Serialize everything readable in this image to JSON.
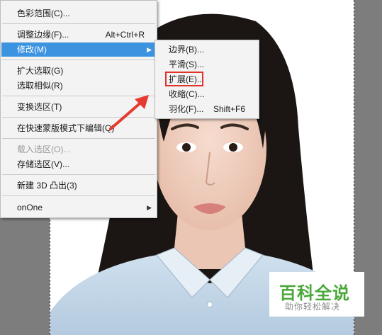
{
  "main_menu": {
    "items": [
      {
        "label": "色彩范围(C)...",
        "shortcut": ""
      },
      {
        "label": "调整边缘(F)...",
        "shortcut": "Alt+Ctrl+R"
      },
      {
        "label": "修改(M)",
        "shortcut": "",
        "active": true,
        "submenu": true
      },
      {
        "label": "扩大选取(G)",
        "shortcut": ""
      },
      {
        "label": "选取相似(R)",
        "shortcut": ""
      },
      {
        "label": "变换选区(T)",
        "shortcut": ""
      },
      {
        "label": "在快速蒙版模式下编辑(Q)",
        "shortcut": ""
      },
      {
        "label": "载入选区(O)...",
        "shortcut": "",
        "disabled": true
      },
      {
        "label": "存储选区(V)...",
        "shortcut": ""
      },
      {
        "label": "新建 3D 凸出(3)",
        "shortcut": ""
      },
      {
        "label": "onOne",
        "shortcut": "",
        "submenu": true
      }
    ]
  },
  "sub_menu": {
    "items": [
      {
        "label": "边界(B)...",
        "shortcut": ""
      },
      {
        "label": "平滑(S)...",
        "shortcut": ""
      },
      {
        "label": "扩展(E)...",
        "shortcut": "",
        "highlighted": true
      },
      {
        "label": "收缩(C)...",
        "shortcut": ""
      },
      {
        "label": "羽化(F)...",
        "shortcut": "Shift+F6"
      }
    ]
  },
  "submenu_arrow_glyph": "▶",
  "watermark": {
    "title": "百科全说",
    "subtitle": "助你轻松解决"
  },
  "colors": {
    "menu_bg": "#f3f3f3",
    "active_item": "#3c93e0",
    "highlight_box": "#e0332a",
    "watermark_green": "#4aa83a",
    "workspace_bg": "#7d7d7d"
  },
  "icons": {
    "pointer": "red-arrow-icon"
  }
}
